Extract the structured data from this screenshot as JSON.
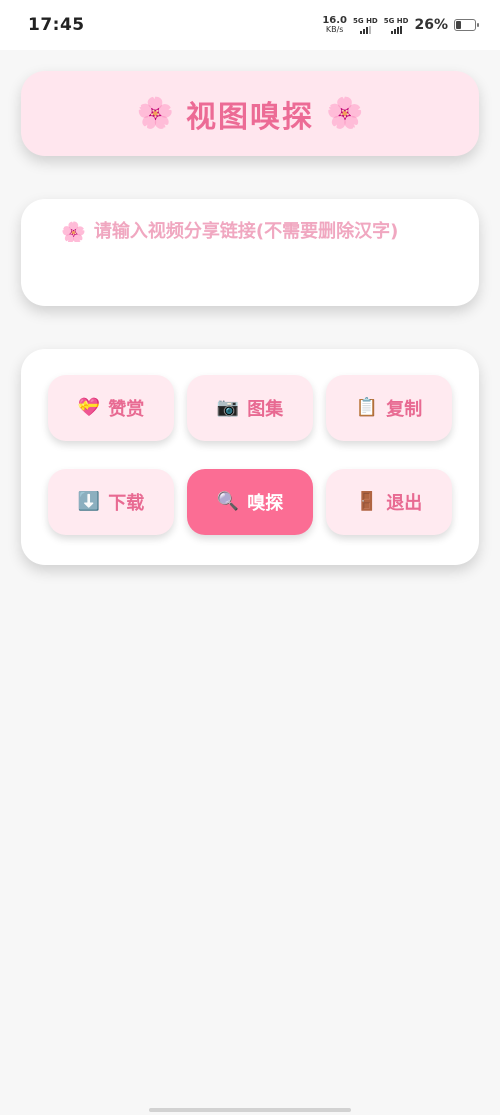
{
  "status_bar": {
    "time": "17:45",
    "net_speed": "16.0",
    "net_unit": "KB/s",
    "sim1_label": "5G HD",
    "sim2_label": "5G HD",
    "battery_percent_text": "26%",
    "battery_level": 0.26
  },
  "header": {
    "title": "视图嗅探",
    "left_icon": "cherry-blossom",
    "right_icon": "cherry-blossom",
    "left_glyph": "🌸",
    "right_glyph": "🌸"
  },
  "url_input": {
    "icon": "cherry-blossom",
    "glyph": "🌸",
    "placeholder": "请输入视频分享链接(不需要删除汉字)",
    "value": ""
  },
  "actions": {
    "reward": {
      "icon": "heart-gift",
      "glyph": "💝",
      "label": "赞赏"
    },
    "gallery": {
      "icon": "camera",
      "glyph": "📷",
      "label": "图集"
    },
    "copy": {
      "icon": "clipboard",
      "glyph": "📋",
      "label": "复制"
    },
    "download": {
      "icon": "down-arrow",
      "glyph": "⬇️",
      "label": "下载"
    },
    "sniff": {
      "icon": "magnifier",
      "glyph": "🔍",
      "label": "嗅探"
    },
    "exit": {
      "icon": "door",
      "glyph": "🚪",
      "label": "退出"
    }
  },
  "colors": {
    "accent": "#ec6b95",
    "primary_button": "#fb6d94",
    "button_bg": "#ffeaf0",
    "title_bg": "#ffe6ee",
    "placeholder": "#f0a7c0"
  }
}
